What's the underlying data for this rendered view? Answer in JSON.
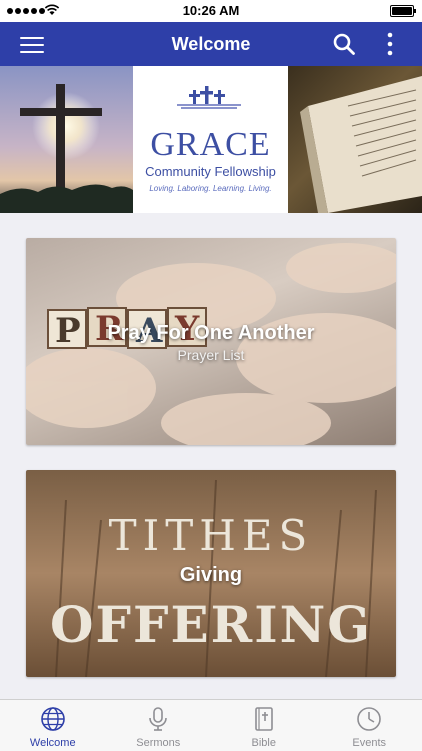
{
  "status_bar": {
    "time": "10:26 AM"
  },
  "nav": {
    "title": "Welcome"
  },
  "banner": {
    "logo_name": "GRACE",
    "logo_sub": "Community Fellowship",
    "logo_tagline": "Loving. Laboring. Learning. Living."
  },
  "cards": [
    {
      "title": "Pray For One Another",
      "subtitle": "Prayer List",
      "image_text": "PRAY"
    },
    {
      "title": "Giving",
      "image_text_top": "TITHES",
      "image_text_mid": "&",
      "image_text_bottom": "OFFERING"
    }
  ],
  "tabs": [
    {
      "label": "Welcome",
      "icon": "globe-icon",
      "active": true
    },
    {
      "label": "Sermons",
      "icon": "microphone-icon",
      "active": false
    },
    {
      "label": "Bible",
      "icon": "bible-icon",
      "active": false
    },
    {
      "label": "Events",
      "icon": "clock-icon",
      "active": false
    }
  ],
  "colors": {
    "primary": "#2e3fa8",
    "tab_inactive": "#8e8e93",
    "logo_blue": "#3d4fa3"
  }
}
